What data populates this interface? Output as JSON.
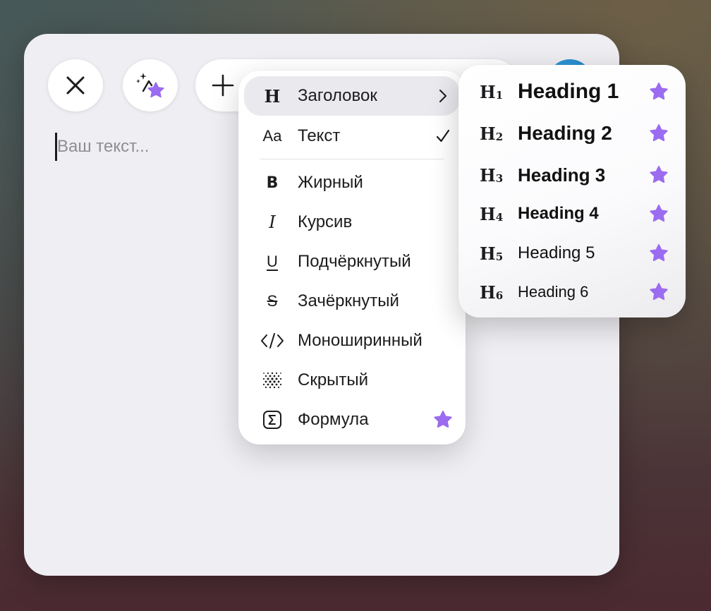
{
  "toolbar": {
    "close_icon": "close-icon",
    "ai_icon": "sparkle-pen-icon",
    "plus_icon": "plus-icon"
  },
  "editor": {
    "placeholder": "Ваш текст..."
  },
  "format_menu": {
    "items": [
      {
        "label": "Заголовок",
        "icon": "heading-icon",
        "trail": "chevron-right-icon"
      },
      {
        "label": "Текст",
        "icon": "text-icon",
        "trail": "checkmark-icon"
      },
      {
        "label": "Жирный",
        "icon": "bold-icon"
      },
      {
        "label": "Курсив",
        "icon": "italic-icon"
      },
      {
        "label": "Подчёркнутый",
        "icon": "underline-icon"
      },
      {
        "label": "Зачёркнутый",
        "icon": "strikethrough-icon"
      },
      {
        "label": "Моноширинный",
        "icon": "code-icon"
      },
      {
        "label": "Скрытый",
        "icon": "spoiler-icon"
      },
      {
        "label": "Формула",
        "icon": "sigma-icon",
        "trail": "premium-star-icon"
      }
    ],
    "text_glyph": "Aa"
  },
  "heading_submenu": {
    "items": [
      {
        "glyph": "H",
        "level": "1",
        "label": "Heading 1"
      },
      {
        "glyph": "H",
        "level": "2",
        "label": "Heading 2"
      },
      {
        "glyph": "H",
        "level": "3",
        "label": "Heading 3"
      },
      {
        "glyph": "H",
        "level": "4",
        "label": "Heading 4"
      },
      {
        "glyph": "H",
        "level": "5",
        "label": "Heading 5"
      },
      {
        "glyph": "H",
        "level": "6",
        "label": "Heading 6"
      }
    ]
  },
  "colors": {
    "premium_star": "#9b6cf0",
    "active_item": "#e9e9ee"
  }
}
